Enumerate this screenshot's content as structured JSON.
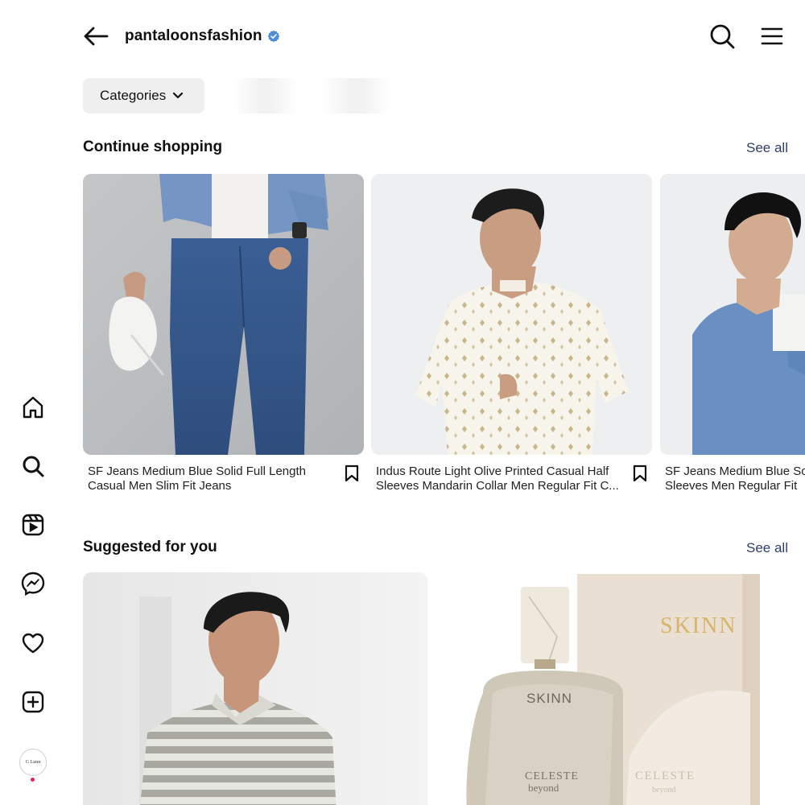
{
  "header": {
    "title": "pantaloonsfashion",
    "verified": true
  },
  "filters": {
    "categories_label": "Categories"
  },
  "sections": [
    {
      "title": "Continue shopping",
      "see_all": "See all",
      "products": [
        {
          "line1": "SF Jeans Medium Blue Solid Full Length",
          "line2": "Casual Men Slim Fit Jeans"
        },
        {
          "line1": "Indus Route Light Olive Printed Casual Half",
          "line2": "Sleeves Mandarin Collar Men Regular Fit C..."
        },
        {
          "line1": "SF Jeans Medium Blue So",
          "line2": "Sleeves Men Regular Fit"
        }
      ]
    },
    {
      "title": "Suggested for you",
      "see_all": "See all",
      "products": [
        {
          "brand_text": ""
        },
        {
          "brand_box": "SKINN",
          "bottle_brand": "SKINN",
          "bottle_name": "CELESTE",
          "bottle_sub": "beyond",
          "box_name": "CELESTE",
          "box_sub": "beyond"
        }
      ]
    }
  ],
  "nav": {
    "items": [
      "home-icon",
      "search-icon",
      "reels-icon",
      "messenger-icon",
      "heart-icon",
      "create-icon"
    ],
    "avatar_text": "G Lunn"
  },
  "colors": {
    "link": "#2e3f6e",
    "verified": "#3897f0",
    "pill_bg": "#efefef"
  }
}
